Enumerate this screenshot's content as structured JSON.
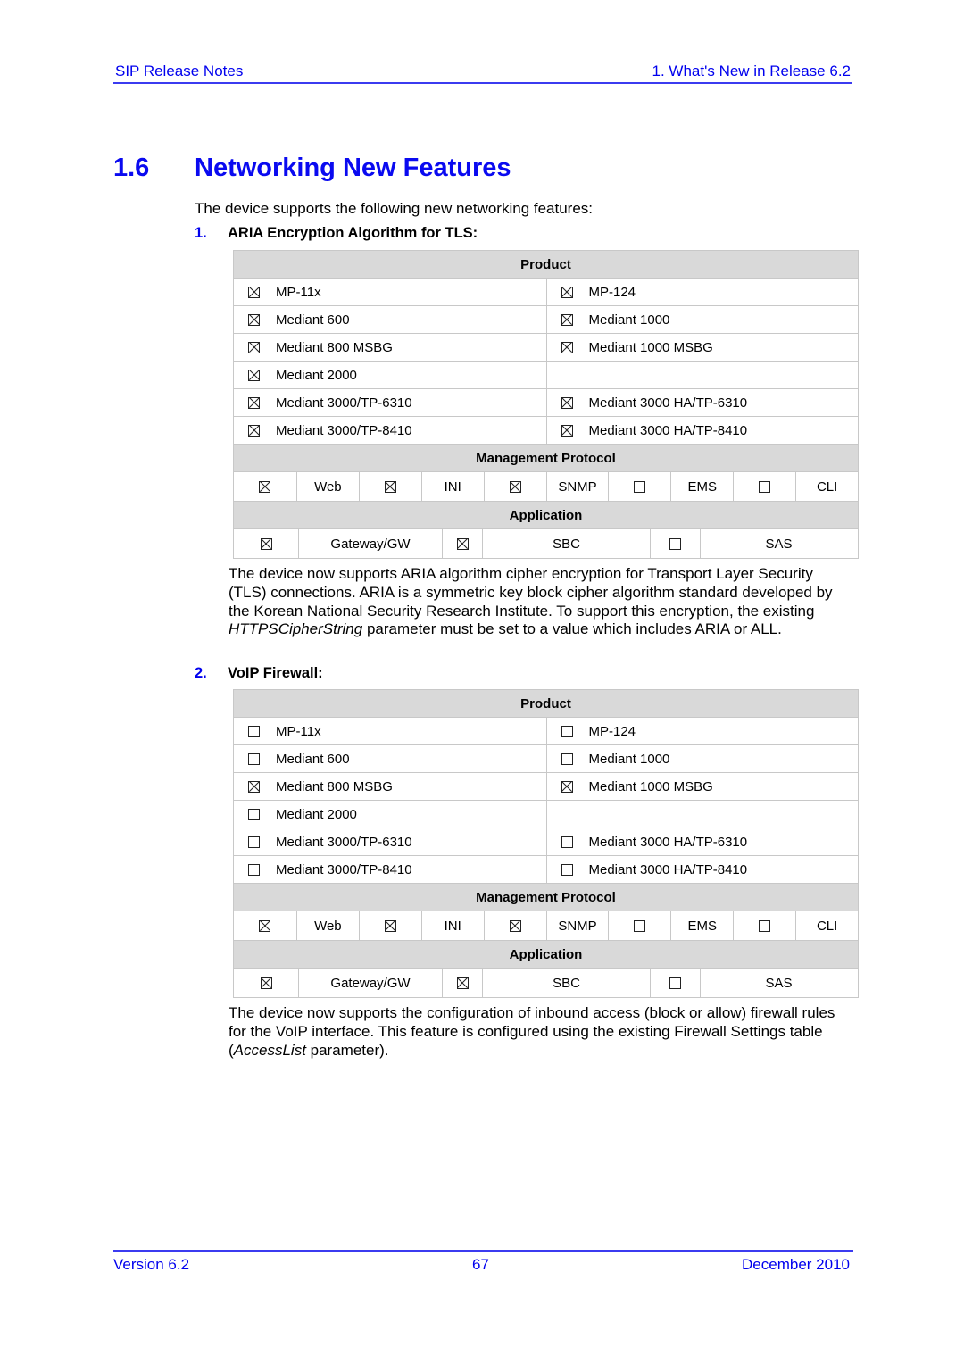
{
  "header": {
    "left": "SIP Release Notes",
    "right": "1. What's New in Release 6.2"
  },
  "section": {
    "number": "1.6",
    "title": "Networking New Features"
  },
  "intro": "The device supports the following new networking features:",
  "features": [
    {
      "number": "1.",
      "title": "ARIA Encryption Algorithm for TLS:",
      "table": {
        "product_header": "Product",
        "products": [
          [
            {
              "label": "MP-11x",
              "checked": true
            },
            {
              "label": "MP-124",
              "checked": true
            }
          ],
          [
            {
              "label": "Mediant 600",
              "checked": true
            },
            {
              "label": "Mediant 1000",
              "checked": true
            }
          ],
          [
            {
              "label": "Mediant 800 MSBG",
              "checked": true
            },
            {
              "label": "Mediant 1000 MSBG",
              "checked": true
            }
          ],
          [
            {
              "label": "Mediant 2000",
              "checked": true
            },
            null
          ],
          [
            {
              "label": "Mediant 3000/TP-6310",
              "checked": true
            },
            {
              "label": "Mediant 3000 HA/TP-6310",
              "checked": true
            }
          ],
          [
            {
              "label": "Mediant 3000/TP-8410",
              "checked": true
            },
            {
              "label": "Mediant 3000 HA/TP-8410",
              "checked": true
            }
          ]
        ],
        "mgmt_header": "Management Protocol",
        "mgmt": [
          {
            "label": "Web",
            "checked": true
          },
          {
            "label": "INI",
            "checked": true
          },
          {
            "label": "SNMP",
            "checked": true
          },
          {
            "label": "EMS",
            "checked": false
          },
          {
            "label": "CLI",
            "checked": false
          }
        ],
        "app_header": "Application",
        "apps": [
          {
            "label": "Gateway/GW",
            "checked": true
          },
          {
            "label": "SBC",
            "checked": true
          },
          {
            "label": "SAS",
            "checked": false
          }
        ]
      },
      "description": {
        "before": "The device now supports ARIA algorithm cipher encryption for Transport Layer Security (TLS) connections. ARIA is a symmetric key block cipher algorithm standard developed by the Korean National Security Research Institute. To support this encryption, the existing ",
        "italic": "HTTPSCipherString",
        "after": " parameter must be set to a value which includes ARIA or ALL."
      }
    },
    {
      "number": "2.",
      "title": "VoIP Firewall:",
      "table": {
        "product_header": "Product",
        "products": [
          [
            {
              "label": "MP-11x",
              "checked": false
            },
            {
              "label": "MP-124",
              "checked": false
            }
          ],
          [
            {
              "label": "Mediant 600",
              "checked": false
            },
            {
              "label": "Mediant 1000",
              "checked": false
            }
          ],
          [
            {
              "label": "Mediant 800 MSBG",
              "checked": true
            },
            {
              "label": "Mediant 1000 MSBG",
              "checked": true
            }
          ],
          [
            {
              "label": "Mediant 2000",
              "checked": false
            },
            null
          ],
          [
            {
              "label": "Mediant 3000/TP-6310",
              "checked": false
            },
            {
              "label": "Mediant 3000 HA/TP-6310",
              "checked": false
            }
          ],
          [
            {
              "label": "Mediant 3000/TP-8410",
              "checked": false
            },
            {
              "label": "Mediant 3000 HA/TP-8410",
              "checked": false
            }
          ]
        ],
        "mgmt_header": "Management Protocol",
        "mgmt": [
          {
            "label": "Web",
            "checked": true
          },
          {
            "label": "INI",
            "checked": true
          },
          {
            "label": "SNMP",
            "checked": true
          },
          {
            "label": "EMS",
            "checked": false
          },
          {
            "label": "CLI",
            "checked": false
          }
        ],
        "app_header": "Application",
        "apps": [
          {
            "label": "Gateway/GW",
            "checked": true
          },
          {
            "label": "SBC",
            "checked": true
          },
          {
            "label": "SAS",
            "checked": false
          }
        ]
      },
      "description": {
        "before": "The device now supports the configuration of inbound access (block or allow) firewall rules for the VoIP interface. This feature is configured using the existing Firewall Settings table (",
        "italic": "AccessList",
        "after": " parameter)."
      }
    }
  ],
  "footer": {
    "left": "Version 6.2",
    "center": "67",
    "right": "December 2010"
  }
}
